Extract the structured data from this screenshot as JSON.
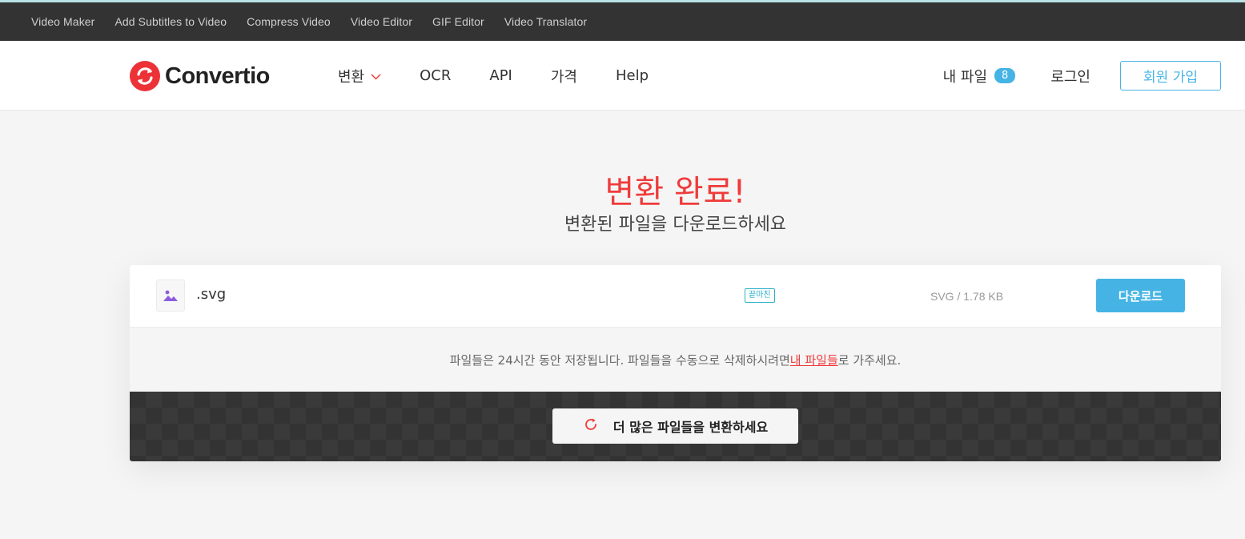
{
  "topbar": {
    "links": [
      "Video Maker",
      "Add Subtitles to Video",
      "Compress Video",
      "Video Editor",
      "GIF Editor",
      "Video Translator"
    ]
  },
  "header": {
    "logo_text": "Convertio",
    "nav": {
      "convert": "변환",
      "ocr": "OCR",
      "api": "API",
      "pricing": "가격",
      "help": "Help"
    },
    "my_files_label": "내 파일",
    "my_files_count": "8",
    "login_label": "로그인",
    "signup_label": "회원 가입"
  },
  "hero": {
    "title": "변환 완료!",
    "subtitle": "변환된 파일을 다운로드하세요"
  },
  "file": {
    "name": ".svg",
    "status": "끝마친",
    "size": "SVG / 1.78 KB",
    "download_label": "다운로드"
  },
  "note": {
    "before": "파일들은 24시간 동안 저장됩니다. 파일들을 수동으로 삭제하시려면 ",
    "link": "내 파일들",
    "after": "로 가주세요."
  },
  "more_button_label": "더 많은 파일들을 변환하세요",
  "colors": {
    "brand_red": "#ed3237",
    "accent_blue": "#45b4e4",
    "topbar_bg": "#333333"
  }
}
